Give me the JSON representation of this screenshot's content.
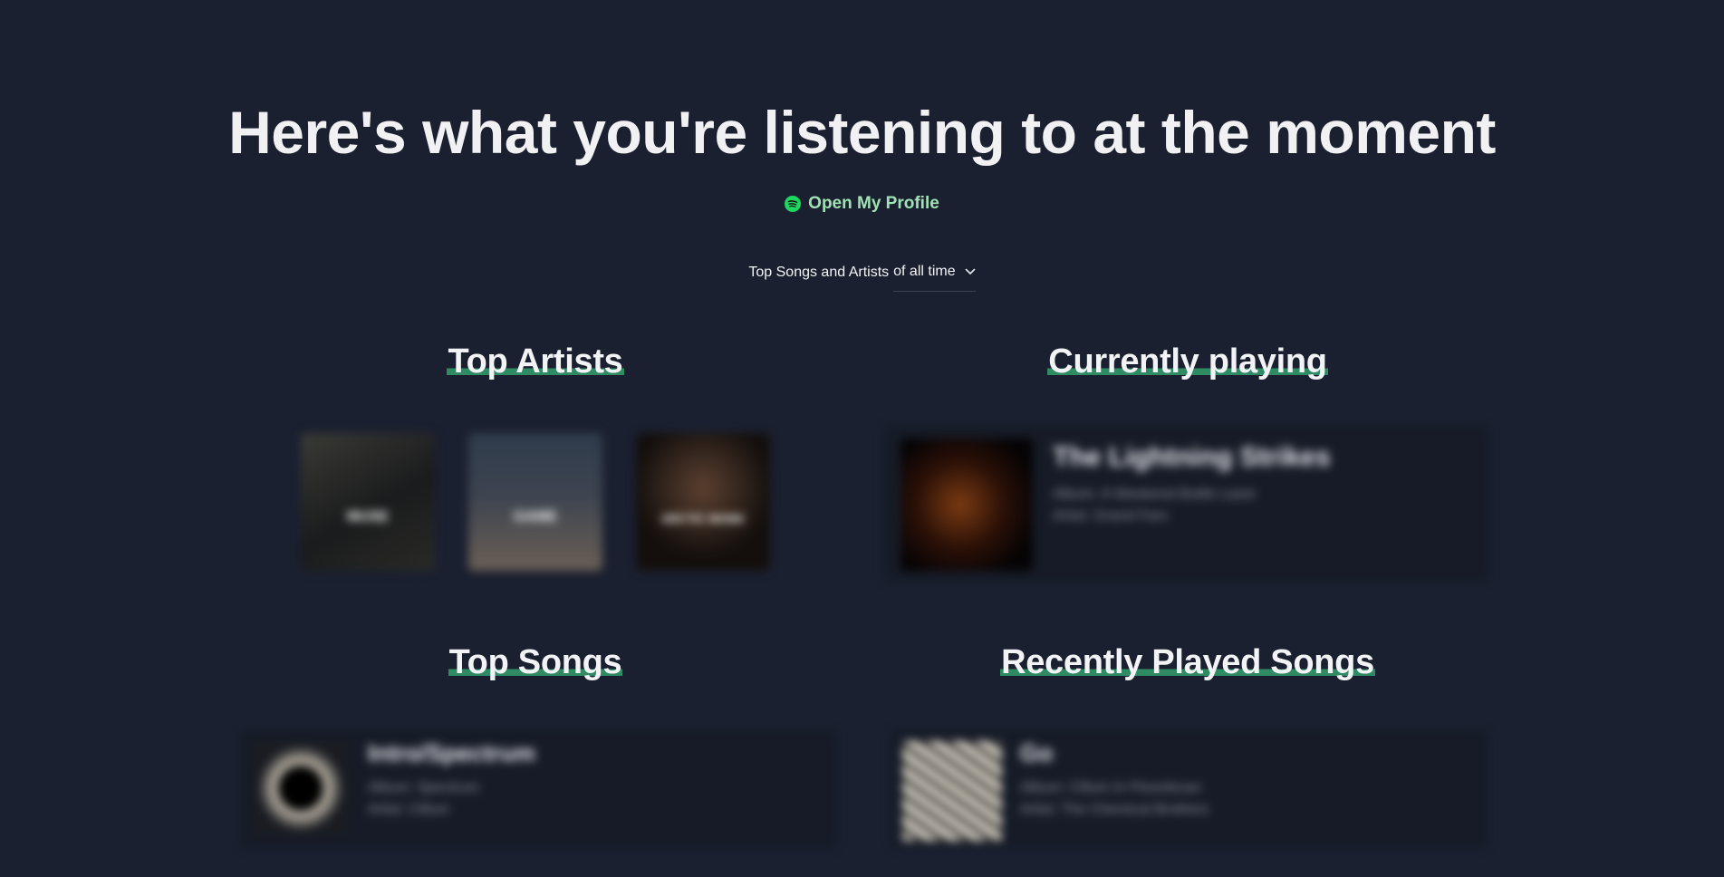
{
  "hero": {
    "title": "Here's what you're listening to at the moment",
    "profile_link": "Open My Profile"
  },
  "range": {
    "prefix": "Top Songs and Artists",
    "selected": "of all time"
  },
  "sections": {
    "top_artists": "Top Artists",
    "currently_playing": "Currently playing",
    "top_songs": "Top Songs",
    "recently_played": "Recently Played Songs"
  },
  "artists": [
    {
      "name": "MUSE"
    },
    {
      "name": "GAME"
    },
    {
      "name": "ARCTIC MONK"
    }
  ],
  "current": {
    "title": "The Lightning Strikes",
    "album": "Album: A Weekend Bottle Laser",
    "artist": "Artist: Grand Fare"
  },
  "top_song": {
    "title": "Intro/Spectrum",
    "album": "Album: Spectrum",
    "artist": "Artist: Cillum"
  },
  "recent_song": {
    "title": "Go",
    "album": "Album: Cillum In Floordscan",
    "artist": "Artist: The Chemical Brothers"
  },
  "colors": {
    "background": "#1b2030",
    "accent": "#2e8b64",
    "spotify_green": "#1ed760",
    "profile_text": "#9fe3b4"
  }
}
